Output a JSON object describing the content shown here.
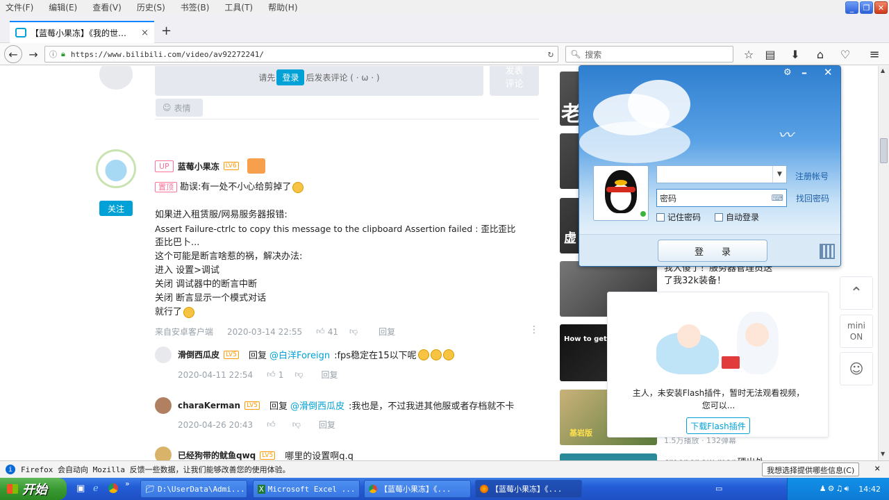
{
  "menubar": {
    "items": [
      "文件(F)",
      "编辑(E)",
      "查看(V)",
      "历史(S)",
      "书签(B)",
      "工具(T)",
      "帮助(H)"
    ]
  },
  "tab": {
    "title": "【蓝莓小果冻】《我的世…",
    "close": "×",
    "new": "+"
  },
  "nav": {
    "url": "https://www.bilibili.com/video/av92272241/",
    "search_placeholder": "搜索"
  },
  "comment_box": {
    "prompt_pre": "请先",
    "login": "登录",
    "prompt_post": "后发表评论 ( · ω · )",
    "submit": "发表\n评论",
    "emoji_btn": "表情"
  },
  "comment_main": {
    "up_badge": "UP",
    "user": "蓝莓小果冻",
    "level": "LV6",
    "follow": "关注",
    "pinned": "置顶",
    "lines": [
      "勘误:有一处不小心给剪掉了",
      "",
      "如果进入租赁服/网易服务器报错:",
      "Assert Failure-ctrlc to copy this message to the clipboard Assertion failed : 歪比歪比",
      "歪比巴卜...",
      "这个可能是断言啥惹的祸，解决办法:",
      "进入 设置>调试",
      "关闭 调试器中的断言中断",
      "关闭 断言显示一个模式对话",
      "就行了"
    ],
    "source": "来自安卓客户端",
    "time": "2020-03-14 22:55",
    "likes": "41",
    "reply": "回复"
  },
  "replies": [
    {
      "user": "滑倒西瓜皮",
      "level": "LV5",
      "prefix": "回复",
      "mention": "@白洋Foreign",
      "text": ":fps稳定在15以下呢",
      "time": "2020-04-11 22:54",
      "likes": "1",
      "reply": "回复"
    },
    {
      "user": "charaKerman",
      "level": "LV5",
      "prefix": "回复",
      "mention": "@滑倒西瓜皮",
      "text": ":我也是，不过我进其他服或者存档就不卡",
      "time": "2020-04-26 20:43",
      "likes": "",
      "reply": "回复"
    },
    {
      "user": "已经狗带的鱿鱼qwq",
      "level": "LV5",
      "prefix": "",
      "mention": "",
      "text": "哪里的设置啊q.q",
      "time": "",
      "likes": "",
      "reply": ""
    }
  ],
  "right": {
    "captions": [
      "我大傻了！服务器管理员送",
      "了我32k装备！"
    ],
    "stats": "1.5万播放 · 132弹幕",
    "caption_last": "creeper aw man硬出处",
    "thumb_texts": [
      "老",
      "虚",
      "How to get N",
      "基岩版"
    ]
  },
  "qq": {
    "settings": "⚙",
    "min": "–",
    "close": "✕",
    "account_placeholder": "",
    "password_placeholder": "密码",
    "register": "注册帐号",
    "recover": "找回密码",
    "remember": "记住密码",
    "autologin": "自动登录",
    "login_btn": "登　　录"
  },
  "flash": {
    "msg1": "主人，未安装Flash插件，暂时无法观看视频，",
    "msg2": "您可以...",
    "download": "下载Flash插件"
  },
  "float": {
    "mini": "mini",
    "on": "ON"
  },
  "notif": {
    "text": "Firefox 会自动向 Mozilla 反馈一些数据，让我们能够改善您的使用体验。",
    "button": "我想选择提供哪些信息(C)",
    "close": "×"
  },
  "taskbar": {
    "start": "开始",
    "tasks": [
      "D:\\UserData\\Admi...",
      "Microsoft Excel ...",
      "【蓝莓小果冻】《...",
      "【蓝莓小果冻】《..."
    ],
    "clock": "14:42"
  }
}
